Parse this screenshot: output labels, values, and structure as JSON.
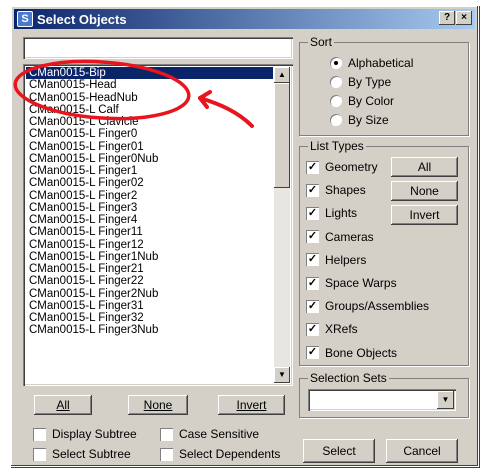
{
  "window": {
    "title": "Select Objects",
    "help_label": "?",
    "close_label": "×"
  },
  "search": {
    "value": ""
  },
  "objects": [
    "CMan0015-Bip",
    "CMan0015-Head",
    "CMan0015-HeadNub",
    "CMan0015-L Calf",
    "CMan0015-L Clavicle",
    "CMan0015-L Finger0",
    "CMan0015-L Finger01",
    "CMan0015-L Finger0Nub",
    "CMan0015-L Finger1",
    "CMan0015-L Finger02",
    "CMan0015-L Finger2",
    "CMan0015-L Finger3",
    "CMan0015-L Finger4",
    "CMan0015-L Finger11",
    "CMan0015-L Finger12",
    "CMan0015-L Finger1Nub",
    "CMan0015-L Finger21",
    "CMan0015-L Finger22",
    "CMan0015-L Finger2Nub",
    "CMan0015-L Finger31",
    "CMan0015-L Finger32",
    "CMan0015-L Finger3Nub"
  ],
  "selected_index": 0,
  "list_buttons": {
    "all": "All",
    "none": "None",
    "invert": "Invert"
  },
  "options": {
    "display_subtree": "Display Subtree",
    "case_sensitive": "Case Sensitive",
    "select_subtree": "Select Subtree",
    "select_dependents": "Select Dependents"
  },
  "sort": {
    "legend": "Sort",
    "options": [
      "Alphabetical",
      "By Type",
      "By Color",
      "By Size"
    ],
    "selected": "Alphabetical"
  },
  "list_types": {
    "legend": "List Types",
    "items": [
      {
        "label": "Geometry",
        "checked": true
      },
      {
        "label": "Shapes",
        "checked": true
      },
      {
        "label": "Lights",
        "checked": true
      },
      {
        "label": "Cameras",
        "checked": true
      },
      {
        "label": "Helpers",
        "checked": true
      },
      {
        "label": "Space Warps",
        "checked": true
      },
      {
        "label": "Groups/Assemblies",
        "checked": true
      },
      {
        "label": "XRefs",
        "checked": true
      },
      {
        "label": "Bone Objects",
        "checked": true
      }
    ],
    "all": "All",
    "none": "None",
    "invert": "Invert"
  },
  "selection_sets": {
    "legend": "Selection Sets",
    "value": ""
  },
  "actions": {
    "select": "Select",
    "cancel": "Cancel"
  },
  "colors": {
    "title_start": "#0a246a",
    "title_end": "#a6caf0",
    "selection": "#0a246a",
    "annotation": "#e8141e",
    "face": "#d4d0c8"
  },
  "icons": [
    "app-icon",
    "help-icon",
    "close-icon",
    "scroll-up-icon",
    "scroll-down-icon",
    "dropdown-arrow-icon",
    "red-arrow-annotation"
  ]
}
